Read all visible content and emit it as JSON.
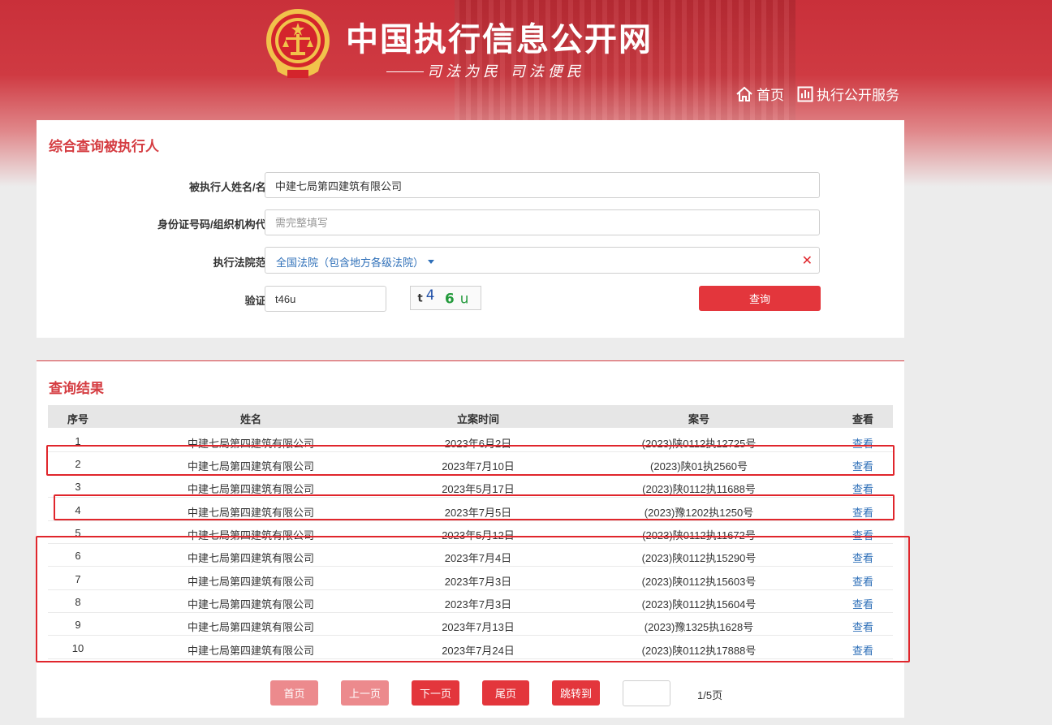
{
  "header": {
    "site_title": "中国执行信息公开网",
    "slogan": "司法为民  司法便民",
    "nav": [
      {
        "label": "首页",
        "icon": "home-icon"
      },
      {
        "label": "执行公开服务",
        "icon": "chart-icon"
      }
    ]
  },
  "search_panel": {
    "title": "综合查询被执行人",
    "name_label": "被执行人姓名/名称:",
    "name_value": "中建七局第四建筑有限公司",
    "id_label": "身份证号码/组织机构代码:",
    "id_placeholder": "需完整填写",
    "court_label": "执行法院范围:",
    "court_value": "全国法院（包含地方各级法院）",
    "clear_symbol": "✕",
    "captcha_label": "验证码:",
    "captcha_value": "t46u",
    "captcha_image_text": [
      "t",
      "4",
      "6",
      "u"
    ],
    "query_button": "查询"
  },
  "results_panel": {
    "title": "查询结果",
    "columns": [
      "序号",
      "姓名",
      "立案时间",
      "案号",
      "查看"
    ],
    "rows": [
      {
        "idx": "1",
        "name": "中建七局第四建筑有限公司",
        "date": "2023年6月2日",
        "case": "(2023)陕0112执12725号",
        "view": "查看"
      },
      {
        "idx": "2",
        "name": "中建七局第四建筑有限公司",
        "date": "2023年7月10日",
        "case": "(2023)陕01执2560号",
        "view": "查看"
      },
      {
        "idx": "3",
        "name": "中建七局第四建筑有限公司",
        "date": "2023年5月17日",
        "case": "(2023)陕0112执11688号",
        "view": "查看"
      },
      {
        "idx": "4",
        "name": "中建七局第四建筑有限公司",
        "date": "2023年7月5日",
        "case": "(2023)豫1202执1250号",
        "view": "查看"
      },
      {
        "idx": "5",
        "name": "中建七局第四建筑有限公司",
        "date": "2023年5月12日",
        "case": "(2023)陕0112执11672号",
        "view": "查看"
      },
      {
        "idx": "6",
        "name": "中建七局第四建筑有限公司",
        "date": "2023年7月4日",
        "case": "(2023)陕0112执15290号",
        "view": "查看"
      },
      {
        "idx": "7",
        "name": "中建七局第四建筑有限公司",
        "date": "2023年7月3日",
        "case": "(2023)陕0112执15603号",
        "view": "查看"
      },
      {
        "idx": "8",
        "name": "中建七局第四建筑有限公司",
        "date": "2023年7月3日",
        "case": "(2023)陕0112执15604号",
        "view": "查看"
      },
      {
        "idx": "9",
        "name": "中建七局第四建筑有限公司",
        "date": "2023年7月13日",
        "case": "(2023)豫1325执1628号",
        "view": "查看"
      },
      {
        "idx": "10",
        "name": "中建七局第四建筑有限公司",
        "date": "2023年7月24日",
        "case": "(2023)陕0112执17888号",
        "view": "查看"
      }
    ]
  },
  "pager": {
    "first": "首页",
    "prev": "上一页",
    "next": "下一页",
    "last": "尾页",
    "jump": "跳转到",
    "page_info": "1/5页"
  },
  "colors": {
    "brand_red": "#e3363c",
    "link_blue": "#2e6fb8",
    "highlight_red": "#e0262c"
  }
}
